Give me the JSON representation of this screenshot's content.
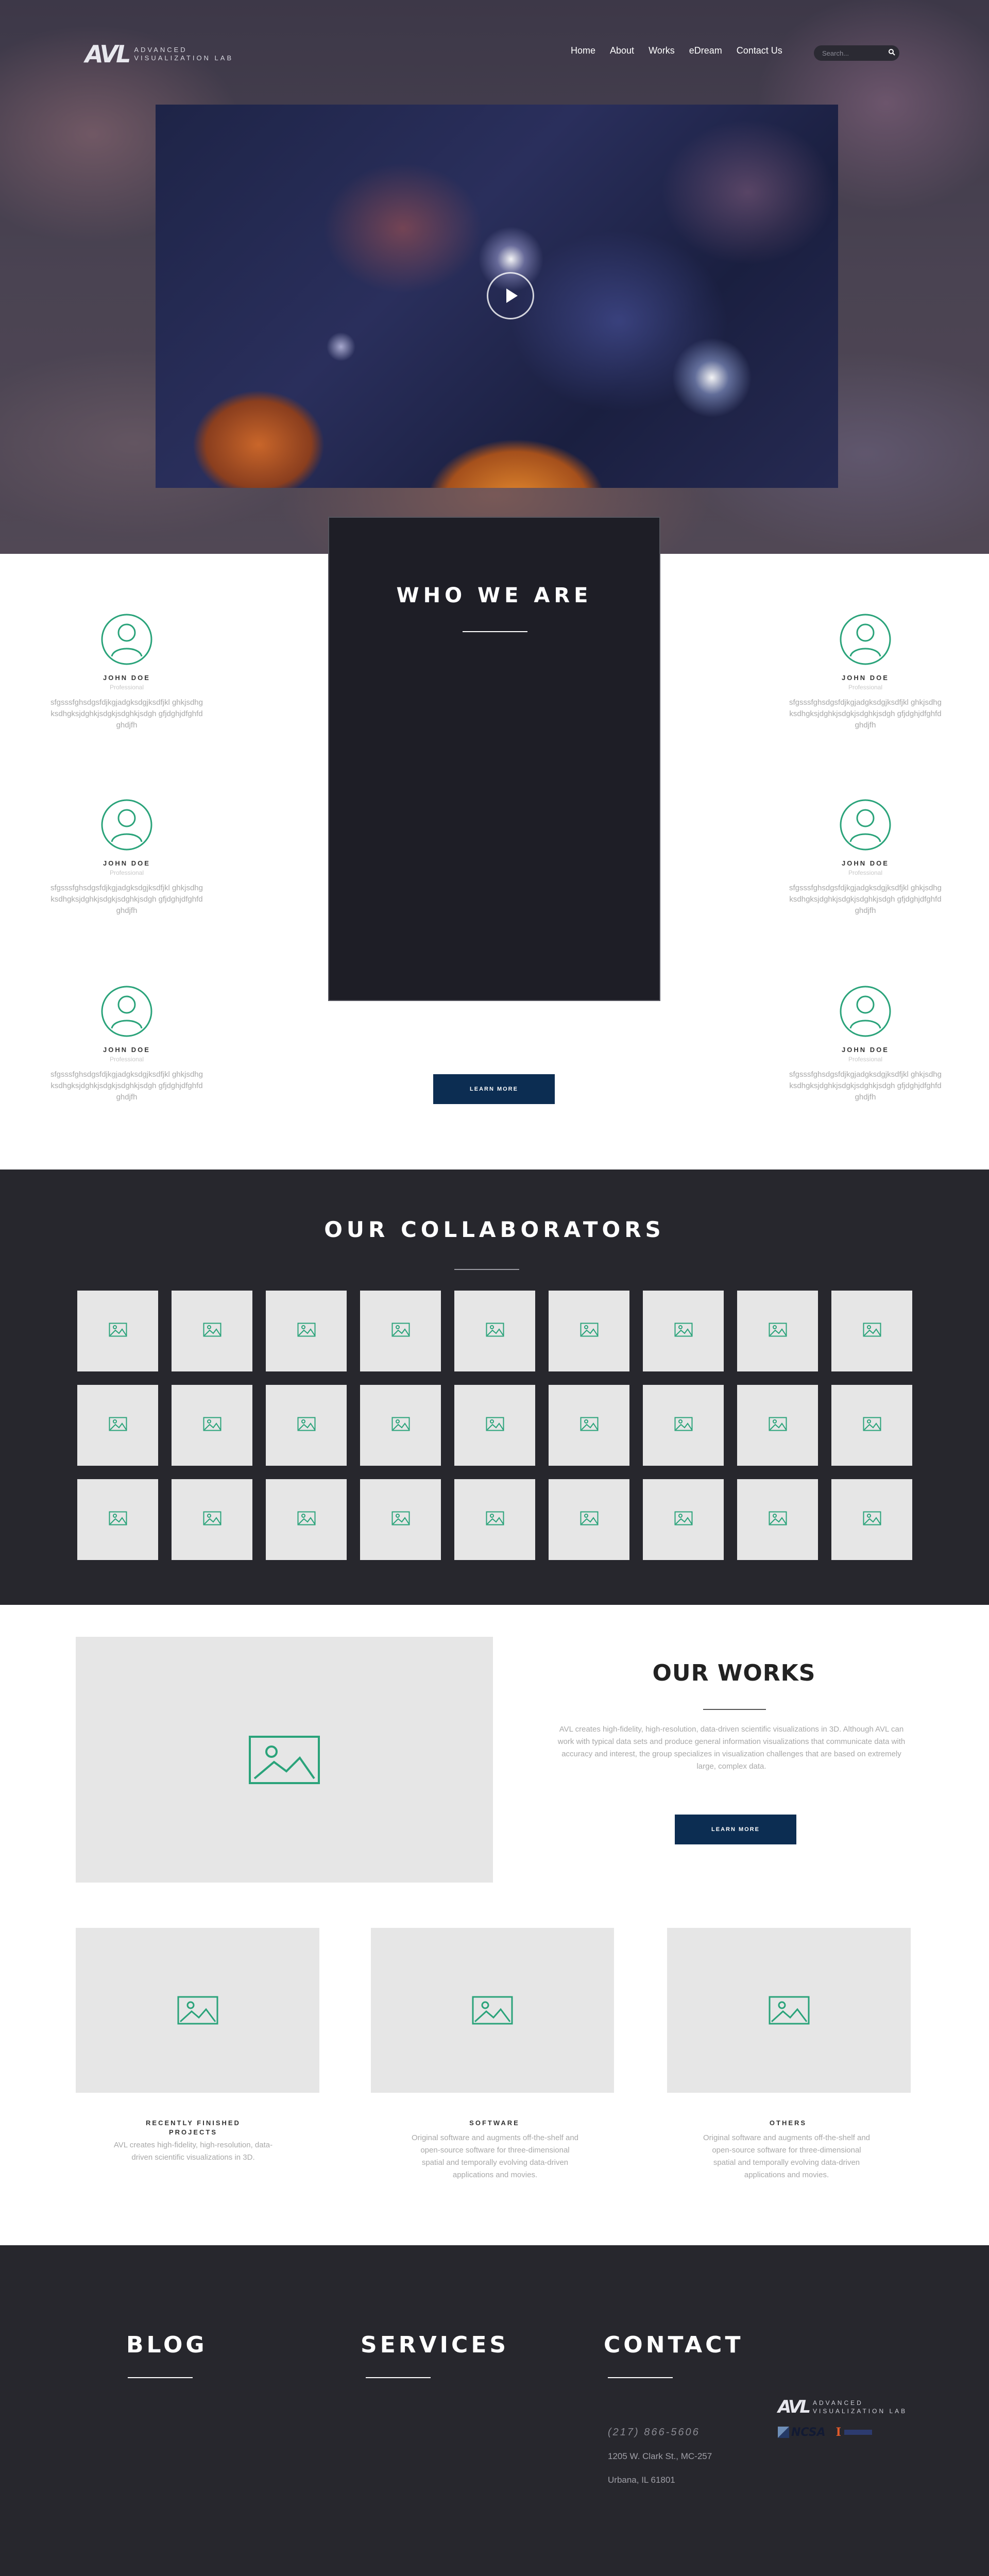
{
  "header": {
    "logo_mark": "AVL",
    "logo_line1": "ADVANCED",
    "logo_line2": "VISUALIZATION LAB",
    "nav": [
      "Home",
      "About",
      "Works",
      "eDream",
      "Contact Us"
    ],
    "search_placeholder": "Search..."
  },
  "who": {
    "title": "WHO WE ARE",
    "learn_more": "LEARN MORE",
    "people": [
      {
        "name": "JOHN DOE",
        "role": "Professional",
        "bio": "sfgsssfghsdgsfdjkgjadgksdgjksdfjkl ghkjsdhgksdhgksjdghkjsdgkjsdghkjsdgh gfjdghjdfghfdghdjfh"
      },
      {
        "name": "JOHN DOE",
        "role": "Professional",
        "bio": "sfgsssfghsdgsfdjkgjadgksdgjksdfjkl ghkjsdhgksdhgksjdghkjsdgkjsdghkjsdgh gfjdghjdfghfdghdjfh"
      },
      {
        "name": "JOHN DOE",
        "role": "Professional",
        "bio": "sfgsssfghsdgsfdjkgjadgksdgjksdfjkl ghkjsdhgksdhgksjdghkjsdgkjsdghkjsdgh gfjdghjdfghfdghdjfh"
      },
      {
        "name": "JOHN DOE",
        "role": "Professional",
        "bio": "sfgsssfghsdgsfdjkgjadgksdgjksdfjkl ghkjsdhgksdhgksjdghkjsdgkjsdghkjsdgh gfjdghjdfghfdghdjfh"
      },
      {
        "name": "JOHN DOE",
        "role": "Professional",
        "bio": "sfgsssfghsdgsfdjkgjadgksdgjksdfjkl ghkjsdhgksdhgksjdghkjsdgkjsdghkjsdgh gfjdghjdfghfdghdjfh"
      },
      {
        "name": "JOHN DOE",
        "role": "Professional",
        "bio": "sfgsssfghsdgsfdjkgjadgksdgjksdfjkl ghkjsdhgksdhgksjdghkjsdgkjsdghkjsdgh gfjdghjdfghfdghdjfh"
      }
    ]
  },
  "collaborators": {
    "title": "OUR COLLABORATORS",
    "tile_icon": "image-placeholder-icon"
  },
  "works": {
    "title": "OUR WORKS",
    "description": "AVL creates high-fidelity, high-resolution, data-driven scientific visualizations in 3D. Although AVL can work with typical data sets and produce general information visualizations that communicate data with accuracy and interest, the group specializes in visualization challenges that are based on extremely large, complex data.",
    "learn_more": "LEARN MORE",
    "cards": [
      {
        "title": "RECENTLY FINISHED PROJECTS",
        "desc": "AVL creates high-fidelity, high-resolution, data-driven scientific visualizations in 3D."
      },
      {
        "title": "SOFTWARE",
        "desc": "Original software and augments off-the-shelf and open-source software for three-dimensional spatial and temporally evolving data-driven applications and movies."
      },
      {
        "title": "OTHERS",
        "desc": "Original software and augments off-the-shelf and open-source software for three-dimensional spatial and temporally evolving data-driven applications and movies."
      }
    ]
  },
  "footer": {
    "blog": "BLOG",
    "services": "SERVICES",
    "contact": "CONTACT",
    "phone": "(217) 866-5606",
    "address1": "1205 W. Clark St., MC-257",
    "address2": "Urbana, IL 61801",
    "logo_mark": "AVL",
    "logo_line1": "ADVANCED",
    "logo_line2": "VISUALIZATION LAB",
    "sponsor1": "NCSA",
    "sponsor2": "I"
  },
  "colors": {
    "accent_green": "#2aa37a",
    "button_navy": "#0c2d52",
    "dark_bg": "#27272d"
  }
}
